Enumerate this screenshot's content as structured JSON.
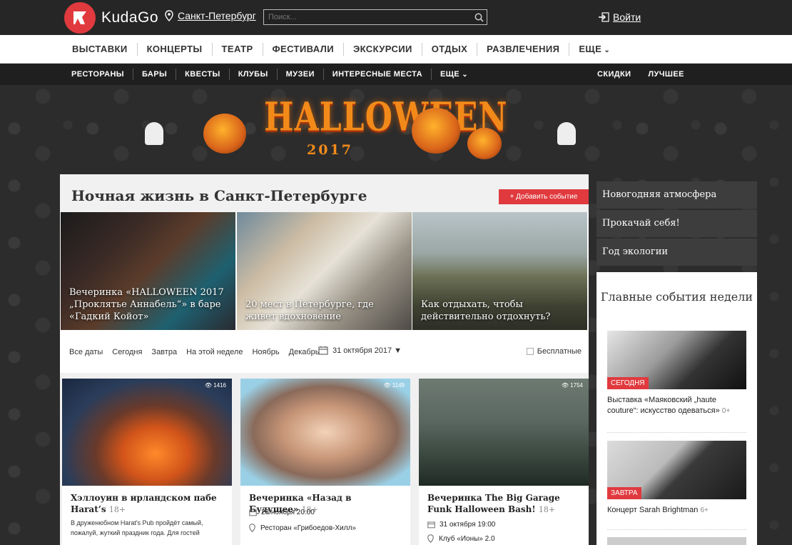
{
  "header": {
    "logo_text": "KudaGo",
    "city": "Санкт-Петербург",
    "search_placeholder": "Поиск...",
    "login": "Войти"
  },
  "main_nav": [
    "ВЫСТАВКИ",
    "КОНЦЕРТЫ",
    "ТЕАТР",
    "ФЕСТИВАЛИ",
    "ЭКСКУРСИИ",
    "ОТДЫХ",
    "РАЗВЛЕЧЕНИЯ",
    "ЕЩЕ"
  ],
  "sub_nav": [
    "РЕСТОРАНЫ",
    "БАРЫ",
    "КВЕСТЫ",
    "КЛУБЫ",
    "МУЗЕИ",
    "ИНТЕРЕСНЫЕ МЕСТА",
    "ЕЩЕ"
  ],
  "sub_nav_right": [
    "СКИДКИ",
    "ЛУЧШЕЕ"
  ],
  "banner": {
    "title": "HALLOWEEN",
    "year": "2017"
  },
  "page": {
    "title": "Ночная жизнь в Санкт-Петербурге",
    "add_button": "+ Добавить событие"
  },
  "featured": [
    {
      "caption": "Вечеринка «HALLOWEEN 2017 „Проклятье Аннабель“» в баре «Гадкий Койот»"
    },
    {
      "caption": "20 мест в Петербурге, где живет вдохновение"
    },
    {
      "caption": "Как отдыхать, чтобы действительно отдохнуть?"
    }
  ],
  "filters": {
    "items": [
      "Все даты",
      "Сегодня",
      "Завтра",
      "На этой неделе",
      "Ноябрь",
      "Декабрь"
    ],
    "date": "31 октября 2017 ▼",
    "free": "Бесплатные"
  },
  "cards": [
    {
      "title": "Хэллоуин в ирландском пабе Harat’s",
      "age": "18+",
      "views": "1416",
      "desc": "В друженюбном Harat's Pub пройдёт самый, пожалуй, жуткий праздник года. Для гостей"
    },
    {
      "title": "Вечеринка «Назад в Будущее»",
      "age": "18+",
      "views": "1149",
      "date": "28 ноября 20:00",
      "place": "Ресторан «Грибоедов-Хилл»"
    },
    {
      "title": "Вечеринка The Big Garage Funk Halloween Bash!",
      "age": "18+",
      "views": "1754",
      "date": "31 октября 19:00",
      "place": "Клуб «Ионы» 2.0"
    }
  ],
  "side_links": [
    "Новогодняя атмосфера",
    "Прокачай себя!",
    "Год экологии"
  ],
  "side_box": {
    "title": "Главные события недели",
    "items": [
      {
        "badge": "СЕГОДНЯ",
        "text": "Выставка «Маяковский „haute couture“: искусство одеваться»",
        "age": "0+"
      },
      {
        "badge": "ЗАВТРА",
        "text": "Концерт Sarah Brightman",
        "age": "6+"
      }
    ]
  },
  "colors": {
    "accent": "#e03a3e",
    "dark": "#262626",
    "banner_orange": "#f28a1a"
  }
}
